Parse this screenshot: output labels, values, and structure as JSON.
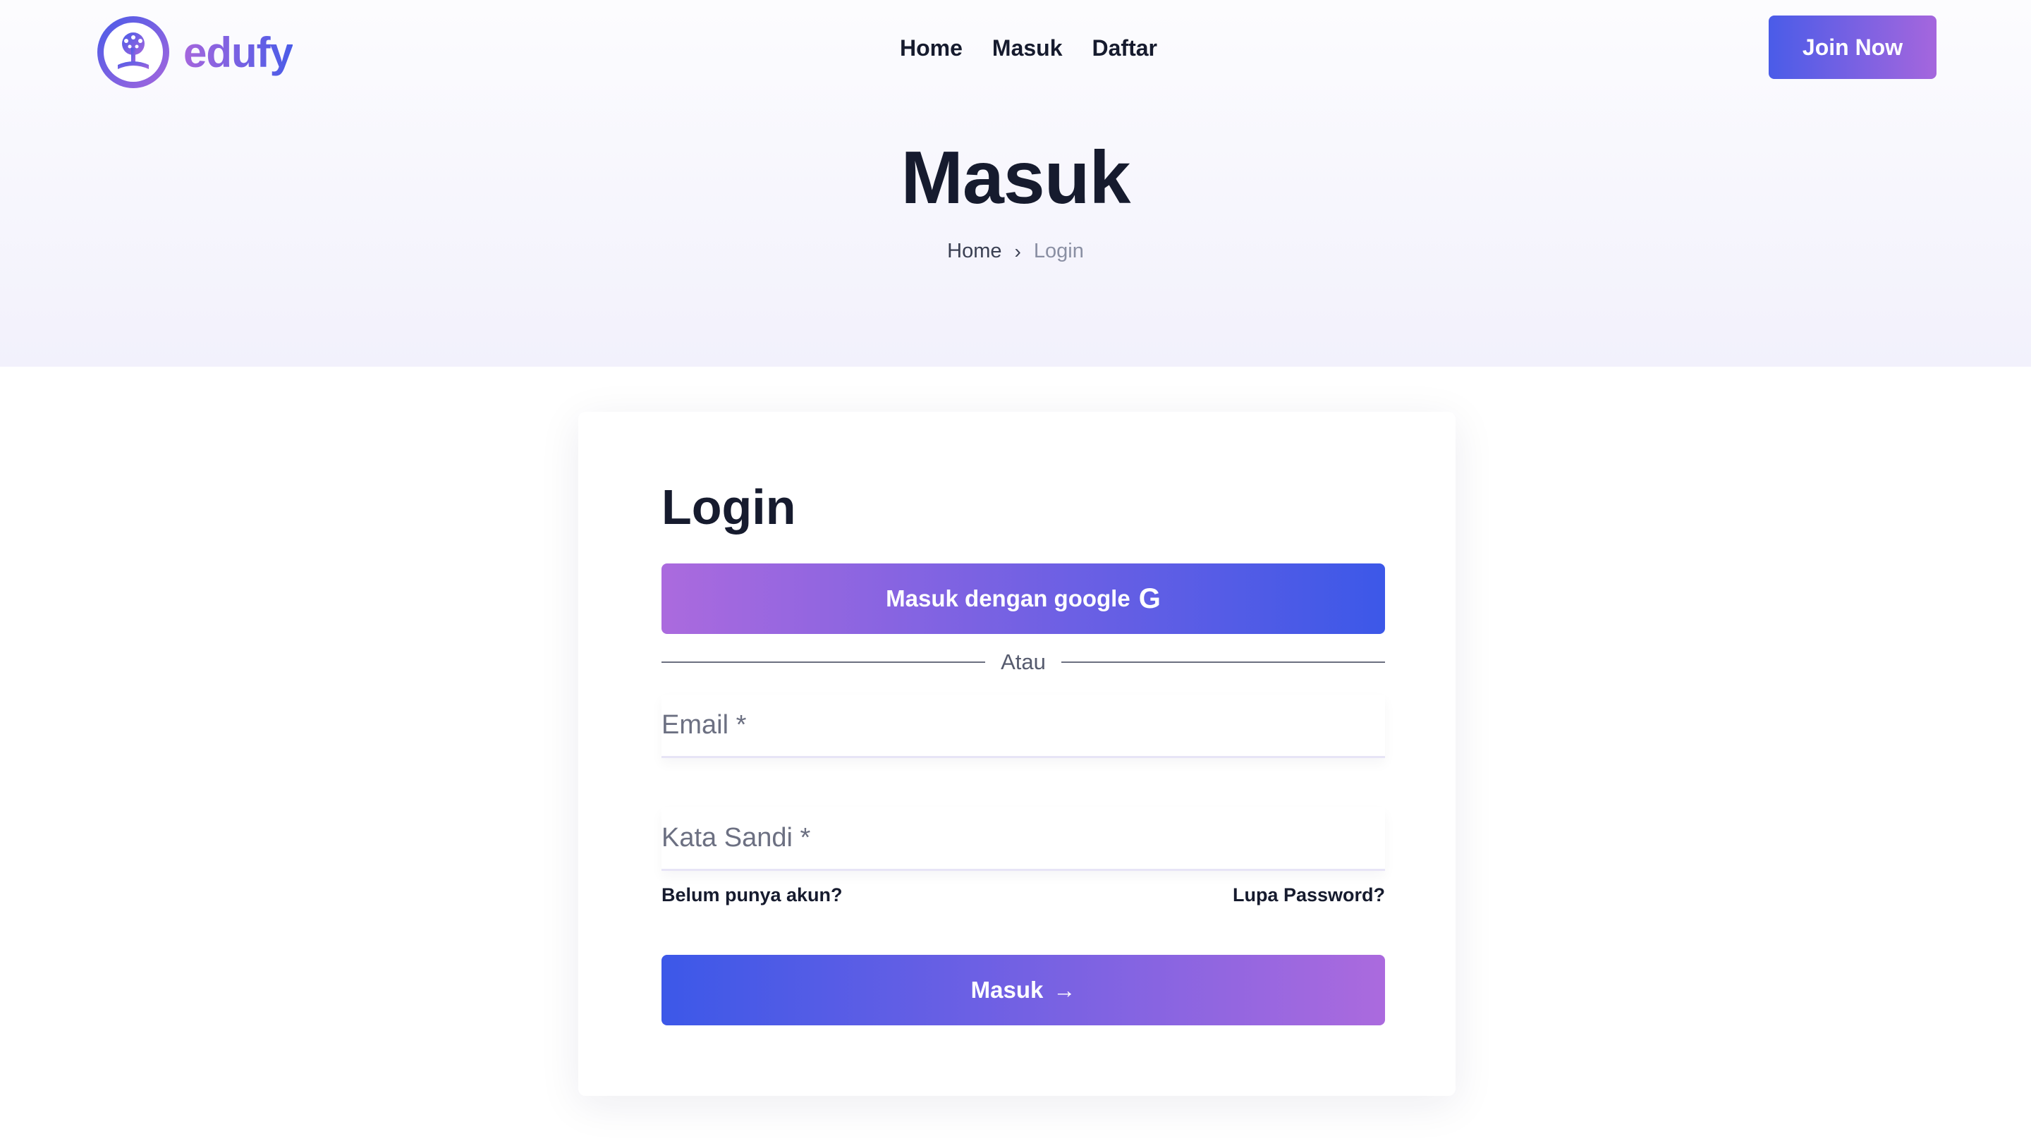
{
  "brand": {
    "name": "edufy"
  },
  "nav": {
    "items": [
      "Home",
      "Masuk",
      "Daftar"
    ]
  },
  "header": {
    "join_label": "Join Now"
  },
  "hero": {
    "title": "Masuk",
    "breadcrumb": {
      "home": "Home",
      "separator": "›",
      "current": "Login"
    }
  },
  "login_card": {
    "title": "Login",
    "google_button": {
      "label": "Masuk dengan google",
      "icon": "google-icon"
    },
    "divider_text": "Atau",
    "email": {
      "placeholder": "Email *",
      "value": ""
    },
    "password": {
      "placeholder": "Kata Sandi *",
      "value": ""
    },
    "no_account_link": "Belum punya akun?",
    "forgot_password_link": "Lupa Password?",
    "submit": {
      "label": "Masuk",
      "icon": "arrow-right-icon"
    }
  },
  "colors": {
    "gradient_blue": "#3c58e8",
    "gradient_purple": "#ab6ade",
    "text_dark": "#161b2e",
    "hero_bg": "#f2f1fc"
  }
}
